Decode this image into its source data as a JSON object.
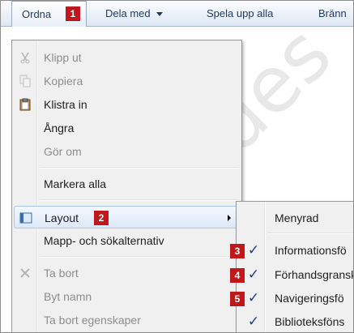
{
  "toolbar": {
    "organize": {
      "label": "Ordna",
      "badge": "1"
    },
    "share": {
      "label": "Dela med"
    },
    "play": {
      "label": "Spela upp alla"
    },
    "burn": {
      "label": "Bränn"
    }
  },
  "watermark": "des",
  "menu": {
    "items": [
      {
        "label": "Klipp ut",
        "icon": "scissors-icon",
        "disabled": true
      },
      {
        "label": "Kopiera",
        "icon": "copy-icon",
        "disabled": true
      },
      {
        "label": "Klistra in",
        "icon": "paste-icon",
        "disabled": false
      },
      {
        "label": "Ångra",
        "disabled": false
      },
      {
        "label": "Gör om",
        "disabled": true
      },
      {
        "label": "Markera alla",
        "disabled": false
      },
      {
        "label": "Layout",
        "icon": "layout-icon",
        "badge": "2",
        "has_submenu": true
      },
      {
        "label": "Mapp- och sökalternativ",
        "disabled": false
      },
      {
        "label": "Ta bort",
        "icon": "delete-x-icon",
        "disabled": true
      },
      {
        "label": "Byt namn",
        "disabled": true
      },
      {
        "label": "Ta bort egenskaper",
        "disabled": true
      }
    ]
  },
  "submenu": {
    "items": [
      {
        "label": "Menyrad",
        "checked": false
      },
      {
        "label": "Informationsfö",
        "checked": true,
        "badge": "3"
      },
      {
        "label": "Förhandsgransk",
        "checked": true,
        "badge": "4"
      },
      {
        "label": "Navigeringsfö",
        "checked": true,
        "badge": "5"
      },
      {
        "label": "Biblioteksföns",
        "checked": true
      }
    ],
    "check_glyph": "✓"
  }
}
